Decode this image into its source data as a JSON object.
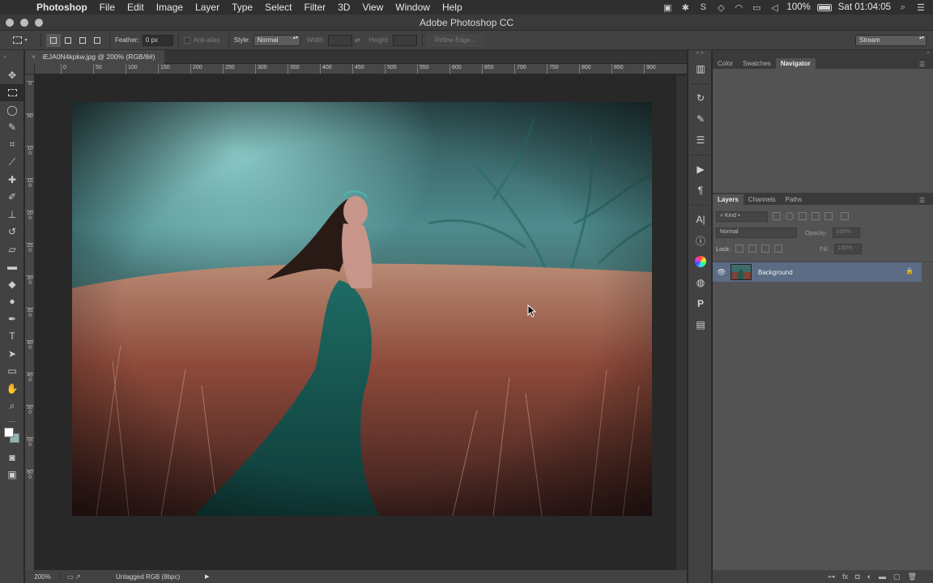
{
  "menubar": {
    "apple_glyph": "",
    "app_name": "Photoshop",
    "menus": [
      "File",
      "Edit",
      "Image",
      "Layer",
      "Type",
      "Select",
      "Filter",
      "3D",
      "View",
      "Window",
      "Help"
    ],
    "battery": "100%",
    "clock": "Sat 01:04:05"
  },
  "window": {
    "title": "Adobe Photoshop CC"
  },
  "options_bar": {
    "feather_label": "Feather:",
    "feather_value": "0 px",
    "anti_alias_label": "Anti-alias",
    "style_label": "Style:",
    "style_value": "Normal",
    "width_label": "Width:",
    "height_label": "Height:",
    "refine_edge_label": "Refine Edge...",
    "workspace_value": "Stream"
  },
  "document": {
    "tab_label": "iEJA0N4kpkw.jpg @ 200% (RGB/8#)",
    "tab_close": "×",
    "ruler_h_labels": [
      "0",
      "50",
      "100",
      "150",
      "200",
      "250",
      "300",
      "350",
      "400",
      "450",
      "500",
      "550",
      "600",
      "650",
      "700",
      "750",
      "800",
      "850",
      "900"
    ],
    "ruler_v_labels": [
      "0",
      "50",
      "100",
      "150",
      "200",
      "250",
      "300",
      "350",
      "400",
      "450",
      "500",
      "550",
      "600"
    ],
    "zoom": "200%",
    "color_profile": "Untagged RGB (8bpc)",
    "status_arrow": "▶"
  },
  "panels": {
    "top_tabs": [
      "Color",
      "Swatches",
      "Navigator"
    ],
    "active_top_tab": "Navigator",
    "layer_tabs": [
      "Layers",
      "Channels",
      "Paths"
    ],
    "active_layer_tab": "Layers",
    "kind_label": "Kind",
    "blend_mode": "Normal",
    "opacity_label": "Opacity:",
    "opacity_value": "100%",
    "lock_label": "Lock:",
    "fill_label": "Fill:",
    "fill_value": "100%",
    "layers": [
      {
        "name": "Background",
        "visible": true,
        "locked": true
      }
    ]
  },
  "colors": {
    "foreground": "#ffffff",
    "background": "#93b4b4",
    "selected_layer": "#5b6c84"
  }
}
